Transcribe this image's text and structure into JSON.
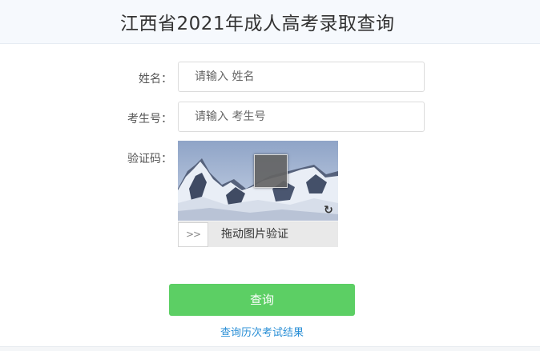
{
  "header": {
    "title": "江西省2021年成人高考录取查询"
  },
  "form": {
    "name_label": "姓名：",
    "name_placeholder": "请输入 姓名",
    "exam_no_label": "考生号：",
    "exam_no_placeholder": "请输入 考生号",
    "captcha_label": "验证码："
  },
  "captcha": {
    "handle_icon": "double-chevron-right-icon",
    "handle_glyph": ">>",
    "slider_text": "拖动图片验证",
    "refresh_icon": "refresh-icon"
  },
  "actions": {
    "query_label": "查询",
    "history_link": "查询历次考试结果"
  },
  "colors": {
    "button": "#5ccf64",
    "link": "#2a8fd6",
    "header_bg": "#f6f9fd"
  }
}
